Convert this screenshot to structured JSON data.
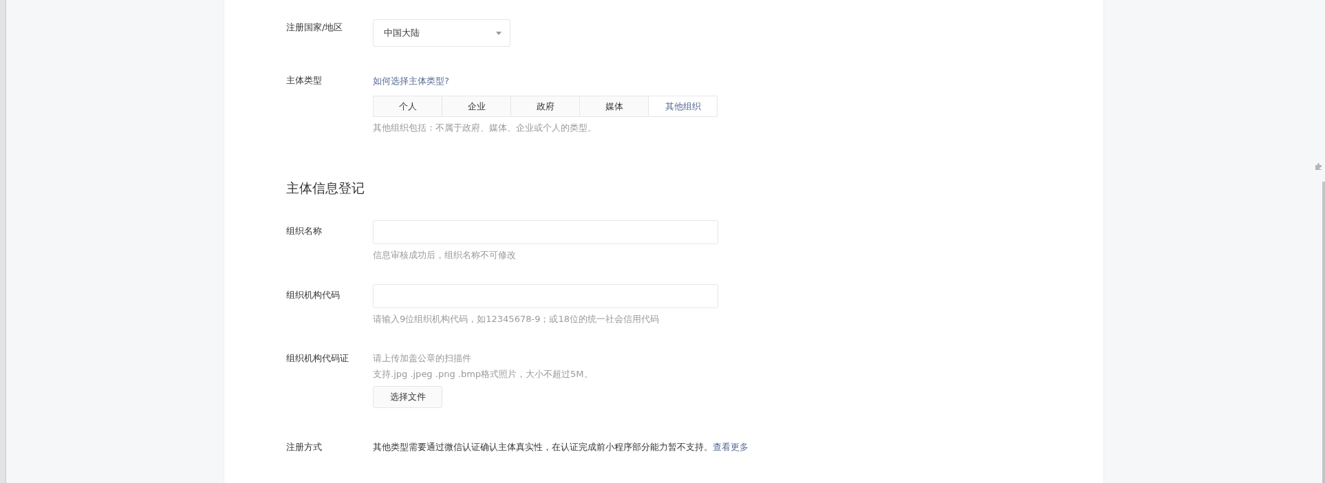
{
  "region": {
    "label": "注册国家/地区",
    "value": "中国大陆"
  },
  "subject_type": {
    "label": "主体类型",
    "help_link": "如何选择主体类型?",
    "options": [
      {
        "label": "个人",
        "selected": false
      },
      {
        "label": "企业",
        "selected": false
      },
      {
        "label": "政府",
        "selected": false
      },
      {
        "label": "媒体",
        "selected": false
      },
      {
        "label": "其他组织",
        "selected": true
      }
    ],
    "hint": "其他组织包括：不属于政府、媒体、企业或个人的类型。"
  },
  "section_title": "主体信息登记",
  "fields": [
    {
      "label": "组织名称",
      "hint": "信息审核成功后，组织名称不可修改"
    },
    {
      "label": "组织机构代码",
      "hint": "请输入9位组织机构代码，如12345678-9；或18位的统一社会信用代码"
    }
  ],
  "upload": {
    "label": "组织机构代码证",
    "hints": [
      "请上传加盖公章的扫描件",
      "支持.jpg .jpeg .png .bmp格式照片，大小不超过5M。"
    ],
    "button": "选择文件"
  },
  "registration": {
    "label": "注册方式",
    "text": "其他类型需要通过微信认证确认主体真实性，在认证完成前小程序部分能力暂不支持。",
    "link": "查看更多"
  }
}
